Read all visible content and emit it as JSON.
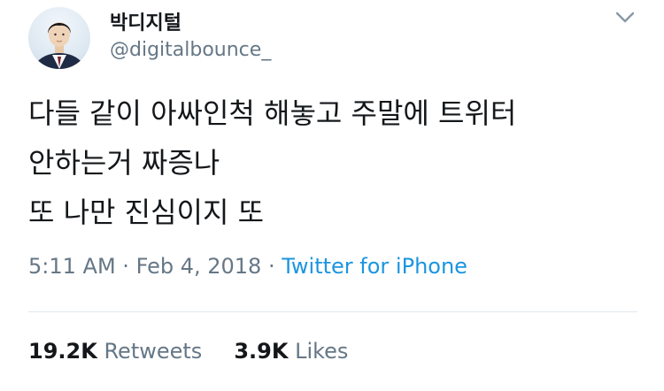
{
  "author": {
    "display_name": "박디지털",
    "handle": "@digitalbounce_",
    "avatar_icon": "profile-photo"
  },
  "tweet": {
    "lines": [
      "다들 같이 아싸인척 해놓고 주말에 트위터",
      "안하는거 짜증나",
      "또 나만 진심이지 또"
    ],
    "time": "5:11 AM",
    "separator": "·",
    "date": "Feb 4, 2018",
    "source": "Twitter for iPhone"
  },
  "stats": {
    "retweets_count": "19.2K",
    "retweets_label": "Retweets",
    "likes_count": "3.9K",
    "likes_label": "Likes"
  },
  "colors": {
    "text": "#14171a",
    "secondary": "#657786",
    "link": "#1b95e0",
    "divider": "#e1e8ed"
  },
  "icons": {
    "menu": "chevron-down-icon"
  }
}
